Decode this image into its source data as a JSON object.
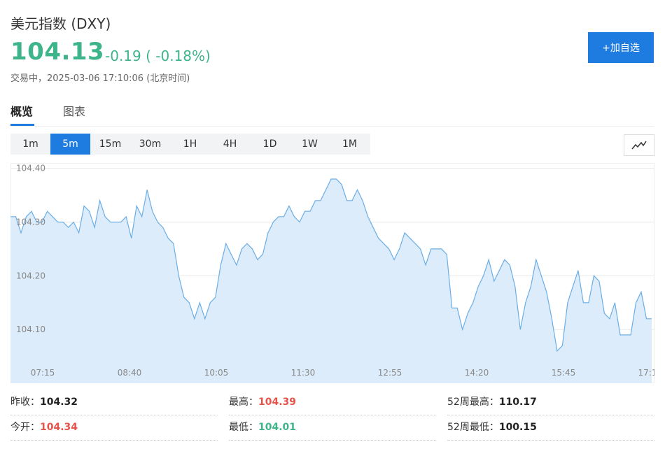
{
  "header": {
    "title": "美元指数 (DXY)",
    "price": "104.13",
    "change": "-0.19 ( -0.18%)",
    "status": "交易中，2025-03-06 17:10:06 (北京时间)",
    "add_label": "+加自选"
  },
  "tabs": [
    {
      "label": "概览",
      "active": true
    },
    {
      "label": "图表",
      "active": false
    }
  ],
  "periods": [
    {
      "label": "1m",
      "active": false
    },
    {
      "label": "5m",
      "active": true
    },
    {
      "label": "15m",
      "active": false
    },
    {
      "label": "30m",
      "active": false
    },
    {
      "label": "1H",
      "active": false
    },
    {
      "label": "4H",
      "active": false
    },
    {
      "label": "1D",
      "active": false
    },
    {
      "label": "1W",
      "active": false
    },
    {
      "label": "1M",
      "active": false
    }
  ],
  "chart_type_icon": "line-chart-icon",
  "colors": {
    "accent": "#1e7be0",
    "down": "#3db489",
    "up": "#e5534b",
    "line": "#6aaee6",
    "fill": "#ddecfa"
  },
  "chart_data": {
    "type": "area",
    "ylim": [
      104.0,
      104.41
    ],
    "y_ticks": [
      "104.40",
      "104.30",
      "104.20",
      "104.10"
    ],
    "y_tick_values": [
      104.4,
      104.3,
      104.2,
      104.1
    ],
    "x_ticks": [
      "07:15",
      "08:40",
      "10:05",
      "11:30",
      "12:55",
      "14:20",
      "15:45",
      "17:1"
    ],
    "values": [
      104.31,
      104.31,
      104.28,
      104.31,
      104.32,
      104.3,
      104.3,
      104.32,
      104.31,
      104.3,
      104.3,
      104.29,
      104.3,
      104.28,
      104.33,
      104.32,
      104.29,
      104.34,
      104.31,
      104.3,
      104.3,
      104.3,
      104.31,
      104.27,
      104.33,
      104.31,
      104.36,
      104.32,
      104.3,
      104.29,
      104.27,
      104.26,
      104.2,
      104.16,
      104.15,
      104.12,
      104.15,
      104.12,
      104.15,
      104.16,
      104.22,
      104.26,
      104.24,
      104.22,
      104.25,
      104.26,
      104.25,
      104.23,
      104.24,
      104.28,
      104.3,
      104.31,
      104.31,
      104.33,
      104.31,
      104.3,
      104.32,
      104.32,
      104.34,
      104.34,
      104.36,
      104.38,
      104.38,
      104.37,
      104.34,
      104.34,
      104.36,
      104.34,
      104.31,
      104.29,
      104.27,
      104.26,
      104.25,
      104.23,
      104.25,
      104.28,
      104.27,
      104.26,
      104.25,
      104.22,
      104.25,
      104.25,
      104.25,
      104.24,
      104.14,
      104.14,
      104.1,
      104.13,
      104.15,
      104.18,
      104.2,
      104.23,
      104.19,
      104.21,
      104.23,
      104.22,
      104.18,
      104.1,
      104.15,
      104.18,
      104.23,
      104.2,
      104.17,
      104.12,
      104.06,
      104.07,
      104.15,
      104.18,
      104.21,
      104.15,
      104.15,
      104.2,
      104.19,
      104.13,
      104.12,
      104.15,
      104.09,
      104.09,
      104.09,
      104.15,
      104.17,
      104.12,
      104.12
    ]
  },
  "stats": {
    "prev_close": {
      "label": "昨收：",
      "value": "104.32"
    },
    "high": {
      "label": "最高：",
      "value": "104.39"
    },
    "high_52w": {
      "label": "52周最高：",
      "value": "110.17"
    },
    "open": {
      "label": "今开：",
      "value": "104.34"
    },
    "low": {
      "label": "最低：",
      "value": "104.01"
    },
    "low_52w": {
      "label": "52周最低：",
      "value": "100.15"
    }
  }
}
